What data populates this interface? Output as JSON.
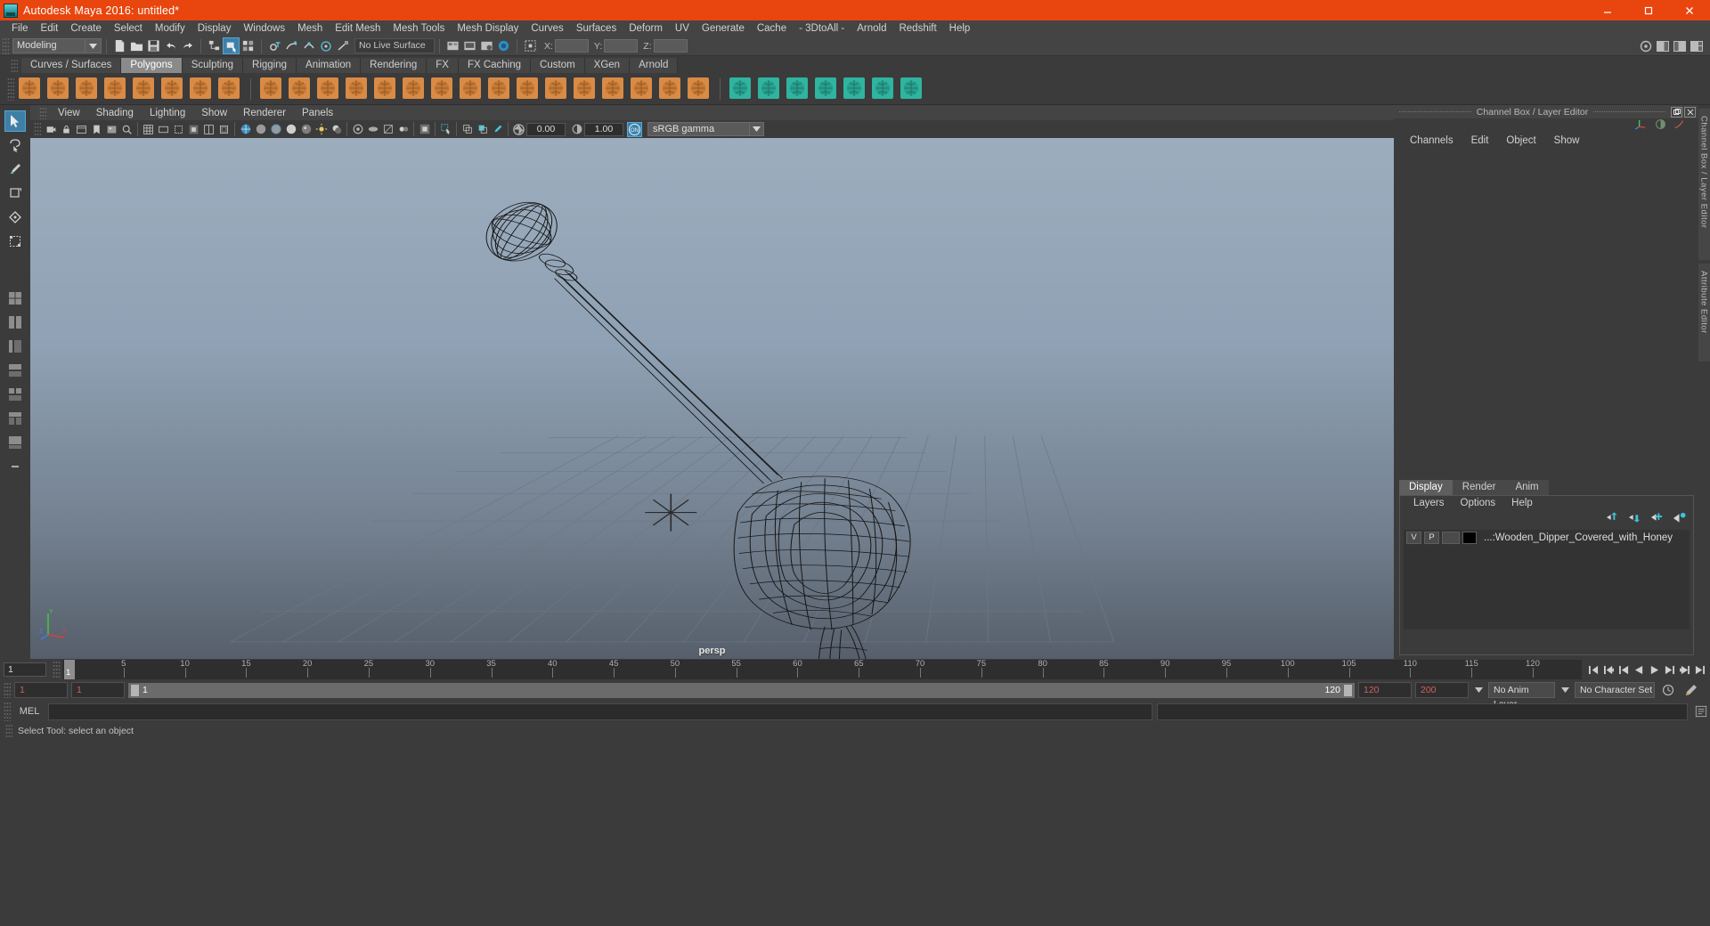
{
  "titlebar": {
    "title": "Autodesk Maya 2016: untitled*",
    "minimize": "minimize-button",
    "maximize": "maximize-button",
    "close": "close-button",
    "accent": "#e8460e"
  },
  "menubar": {
    "items": [
      "File",
      "Edit",
      "Create",
      "Select",
      "Modify",
      "Display",
      "Windows",
      "Mesh",
      "Edit Mesh",
      "Mesh Tools",
      "Mesh Display",
      "Curves",
      "Surfaces",
      "Deform",
      "UV",
      "Generate",
      "Cache",
      "- 3DtoAll -",
      "Arnold",
      "Redshift",
      "Help"
    ]
  },
  "toolbar": {
    "mode": "Modeling",
    "live_surface": "No Live Surface",
    "coord_labels": [
      "X:",
      "Y:",
      "Z:"
    ],
    "coord_values": [
      "",
      "",
      ""
    ]
  },
  "shelf": {
    "tabs": [
      "Curves / Surfaces",
      "Polygons",
      "Sculpting",
      "Rigging",
      "Animation",
      "Rendering",
      "FX",
      "FX Caching",
      "Custom",
      "XGen",
      "Arnold"
    ],
    "active_tab": "Polygons"
  },
  "viewport_panel": {
    "menu": [
      "View",
      "Shading",
      "Lighting",
      "Show",
      "Renderer",
      "Panels"
    ],
    "exposure": "0.00",
    "gamma_value": "1.00",
    "color_space": "sRGB gamma",
    "camera_label": "persp",
    "axis_labels": {
      "y": "Y",
      "z": "Z",
      "x": "X"
    }
  },
  "channelbox": {
    "title": "Channel Box / Layer Editor",
    "menu": [
      "Channels",
      "Edit",
      "Object",
      "Show"
    ]
  },
  "layer_editor": {
    "tabs": [
      "Display",
      "Render",
      "Anim"
    ],
    "active_tab": "Display",
    "menu": [
      "Layers",
      "Options",
      "Help"
    ],
    "layers": [
      {
        "visibility": "V",
        "playback": "P",
        "shading": "",
        "color": "#000000",
        "name": "...:Wooden_Dipper_Covered_with_Honey"
      }
    ]
  },
  "sidebar_tabs": [
    "Channel Box / Layer Editor",
    "Attribute Editor"
  ],
  "timeline": {
    "current_frame": "1",
    "ticks": [
      5,
      10,
      15,
      20,
      25,
      30,
      35,
      40,
      45,
      50,
      55,
      60,
      65,
      70,
      75,
      80,
      85,
      90,
      95,
      100,
      105,
      110,
      115,
      120
    ],
    "frame_field": "1",
    "range_start": "1",
    "range_end": "1",
    "slider_start": "1",
    "slider_end": "120",
    "anim_end": "120",
    "playback_end": "200",
    "anim_layer": "No Anim Layer",
    "character_set": "No Character Set"
  },
  "command_line": {
    "label": "MEL",
    "value": "",
    "placeholder": ""
  },
  "statusbar": {
    "message": "Select Tool: select an object"
  }
}
